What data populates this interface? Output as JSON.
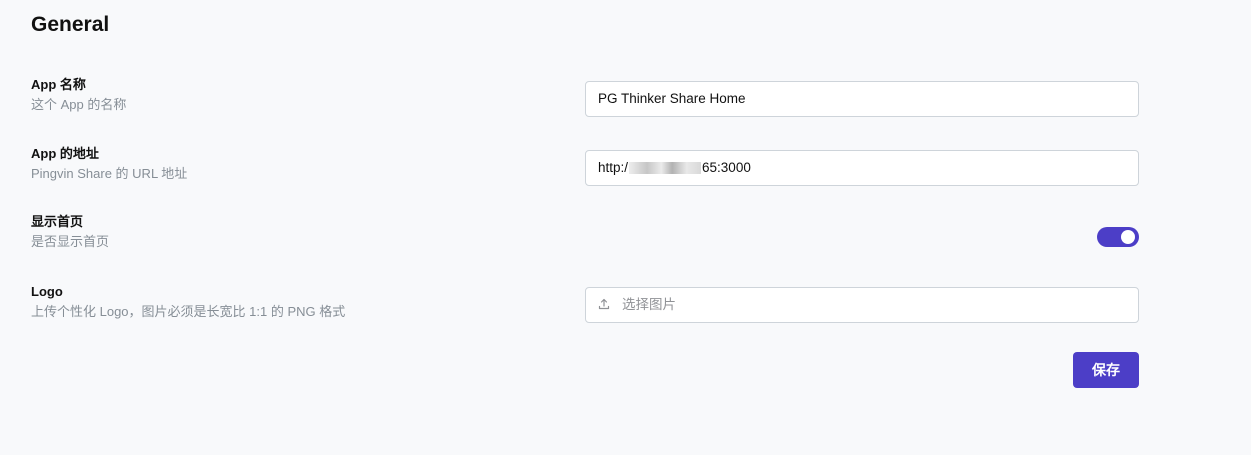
{
  "page": {
    "title": "General"
  },
  "settings": {
    "app_name": {
      "label": "App 名称",
      "description": "这个 App 的名称",
      "value": "PG Thinker Share Home"
    },
    "app_url": {
      "label": "App 的地址",
      "description": "Pingvin Share 的 URL 地址",
      "value_prefix": "http:/",
      "value_suffix": "65:3000"
    },
    "show_home": {
      "label": "显示首页",
      "description": "是否显示首页",
      "enabled": true
    },
    "logo": {
      "label": "Logo",
      "description": "上传个性化 Logo，图片必须是长宽比 1:1 的 PNG 格式",
      "placeholder": "选择图片",
      "icon": "upload-icon"
    }
  },
  "actions": {
    "save_label": "保存"
  },
  "colors": {
    "accent": "#4c3ec7",
    "background": "#f8f9fb",
    "muted": "#868e96"
  }
}
